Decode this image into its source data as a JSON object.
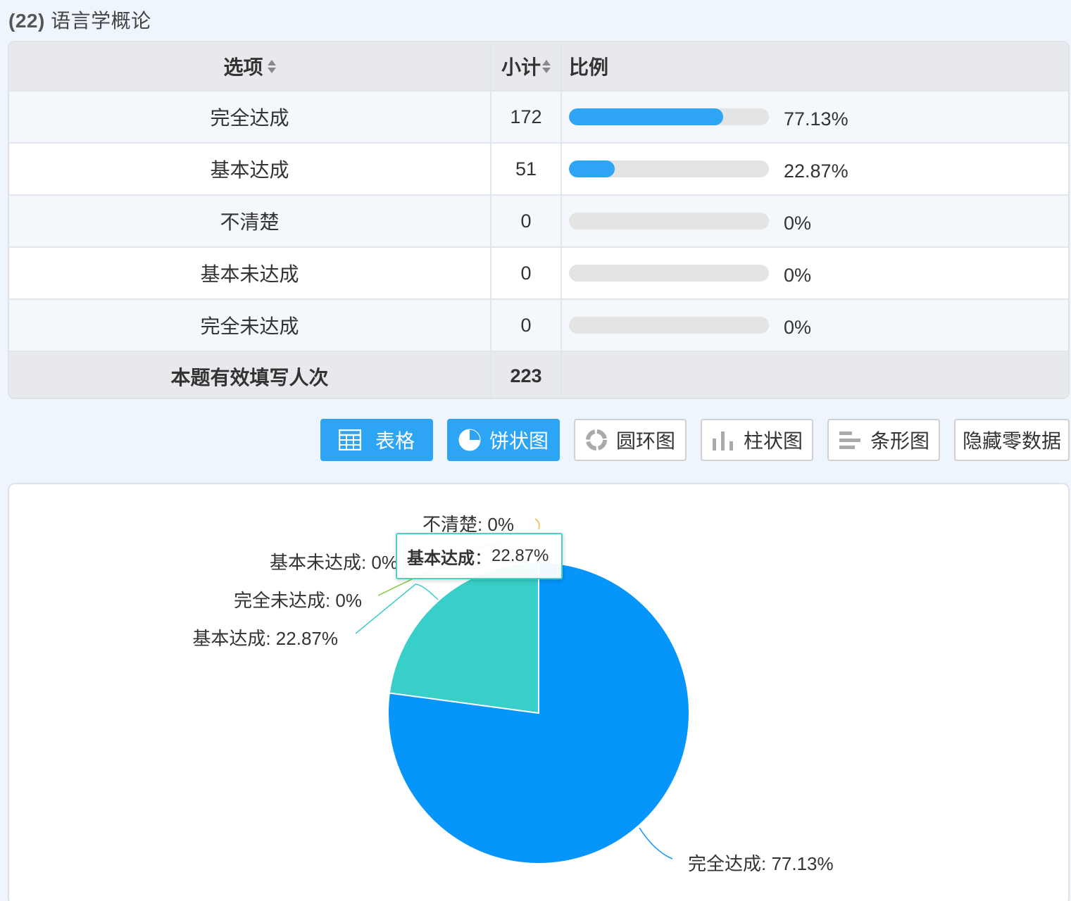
{
  "question": {
    "number": "(22)",
    "title": "语言学概论"
  },
  "table": {
    "headers": {
      "option": "选项",
      "count": "小计",
      "ratio": "比例"
    },
    "rows": [
      {
        "option": "完全达成",
        "count": "172",
        "percent_label": "77.13%",
        "percent": 77.13
      },
      {
        "option": "基本达成",
        "count": "51",
        "percent_label": "22.87%",
        "percent": 22.87
      },
      {
        "option": "不清楚",
        "count": "0",
        "percent_label": "0%",
        "percent": 0
      },
      {
        "option": "基本未达成",
        "count": "0",
        "percent_label": "0%",
        "percent": 0
      },
      {
        "option": "完全未达成",
        "count": "0",
        "percent_label": "0%",
        "percent": 0
      }
    ],
    "footer": {
      "label": "本题有效填写人次",
      "count": "223"
    }
  },
  "buttons": {
    "table": "表格",
    "pie": "饼状图",
    "donut": "圆环图",
    "column": "柱状图",
    "bar": "条形图",
    "hide_zero": "隐藏零数据"
  },
  "colors": {
    "accent": "#2ea4f5",
    "slice_main": "#0595fb",
    "slice_second": "#37cfc7"
  },
  "tooltip": {
    "name": "基本达成",
    "value": "22.87%"
  },
  "chart_data": {
    "type": "pie",
    "categories": [
      "完全达成",
      "基本达成",
      "不清楚",
      "基本未达成",
      "完全未达成"
    ],
    "values": [
      77.13,
      22.87,
      0,
      0,
      0
    ],
    "labels": [
      "完全达成: 77.13%",
      "基本达成: 22.87%",
      "不清楚: 0%",
      "基本未达成: 0%",
      "完全未达成: 0%"
    ],
    "colors": [
      "#0595fb",
      "#37cfc7",
      "#f5b73b",
      "#8cc63f",
      "#37cfc7"
    ]
  }
}
